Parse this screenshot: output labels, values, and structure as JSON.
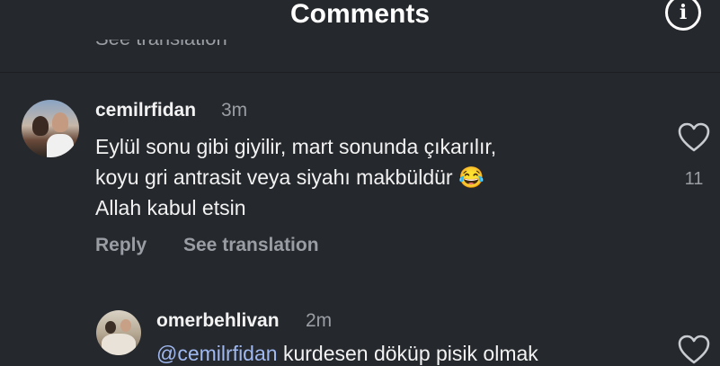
{
  "header": {
    "title": "Comments",
    "info_glyph": "i",
    "info_icon": "info-icon"
  },
  "previous": {
    "see_translation": "See translation"
  },
  "comments": [
    {
      "username": "cemilrfidan",
      "time": "3m",
      "lines": [
        "Eylül sonu gibi giyilir, mart sonunda çıkarılır,",
        "koyu gri antrasit veya siyahı makbüldür 😂",
        "Allah kabul etsin"
      ],
      "likes": "11",
      "reply_label": "Reply",
      "translate_label": "See translation"
    },
    {
      "username": "omerbehlivan",
      "time": "2m",
      "mention": "@cemilrfidan",
      "text": " kurdesen döküp pisik olmak"
    }
  ],
  "colors": {
    "background": "#25282c",
    "text": "#f2f2f2",
    "muted": "#9a9ea4",
    "mention": "#9fb8f0"
  }
}
